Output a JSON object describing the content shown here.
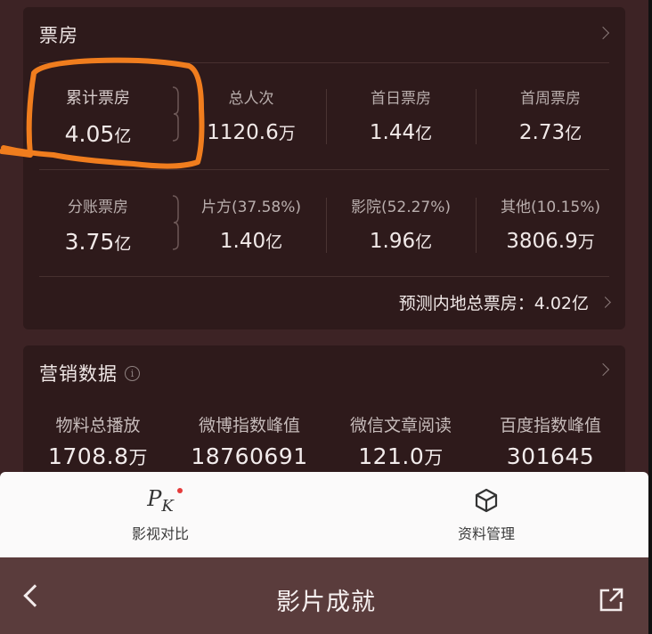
{
  "boxoffice": {
    "title": "票房",
    "row1": [
      {
        "label": "累计票房",
        "num": "4.05",
        "unit": "亿"
      },
      {
        "label": "总人次",
        "num": "1120.6",
        "unit": "万"
      },
      {
        "label": "首日票房",
        "num": "1.44",
        "unit": "亿"
      },
      {
        "label": "首周票房",
        "num": "2.73",
        "unit": "亿"
      }
    ],
    "row2": [
      {
        "label": "分账票房",
        "num": "3.75",
        "unit": "亿"
      },
      {
        "label": "片方(37.58%)",
        "num": "1.40",
        "unit": "亿"
      },
      {
        "label": "影院(52.27%)",
        "num": "1.96",
        "unit": "亿"
      },
      {
        "label": "其他(10.15%)",
        "num": "3806.9",
        "unit": "万"
      }
    ],
    "forecast": "预测内地总票房：4.02亿"
  },
  "marketing": {
    "title": "营销数据",
    "info_icon": "info-icon",
    "stats": [
      {
        "label": "物料总播放",
        "num": "1708.8",
        "unit": "万"
      },
      {
        "label": "微博指数峰值",
        "num": "18760691",
        "unit": ""
      },
      {
        "label": "微信文章阅读",
        "num": "121.0",
        "unit": "万"
      },
      {
        "label": "百度指数峰值",
        "num": "301645",
        "unit": ""
      }
    ]
  },
  "actions": {
    "compare_icon_text": "P",
    "compare_icon_sub": "K",
    "compare_label": "影视对比",
    "materials_label": "资料管理"
  },
  "bottom_bar": {
    "title": "影片成就"
  },
  "colors": {
    "background": "#3d2325",
    "card": "#2e1a1b",
    "highlight": "#f07d1e",
    "pk_dot": "#e53b3b"
  }
}
